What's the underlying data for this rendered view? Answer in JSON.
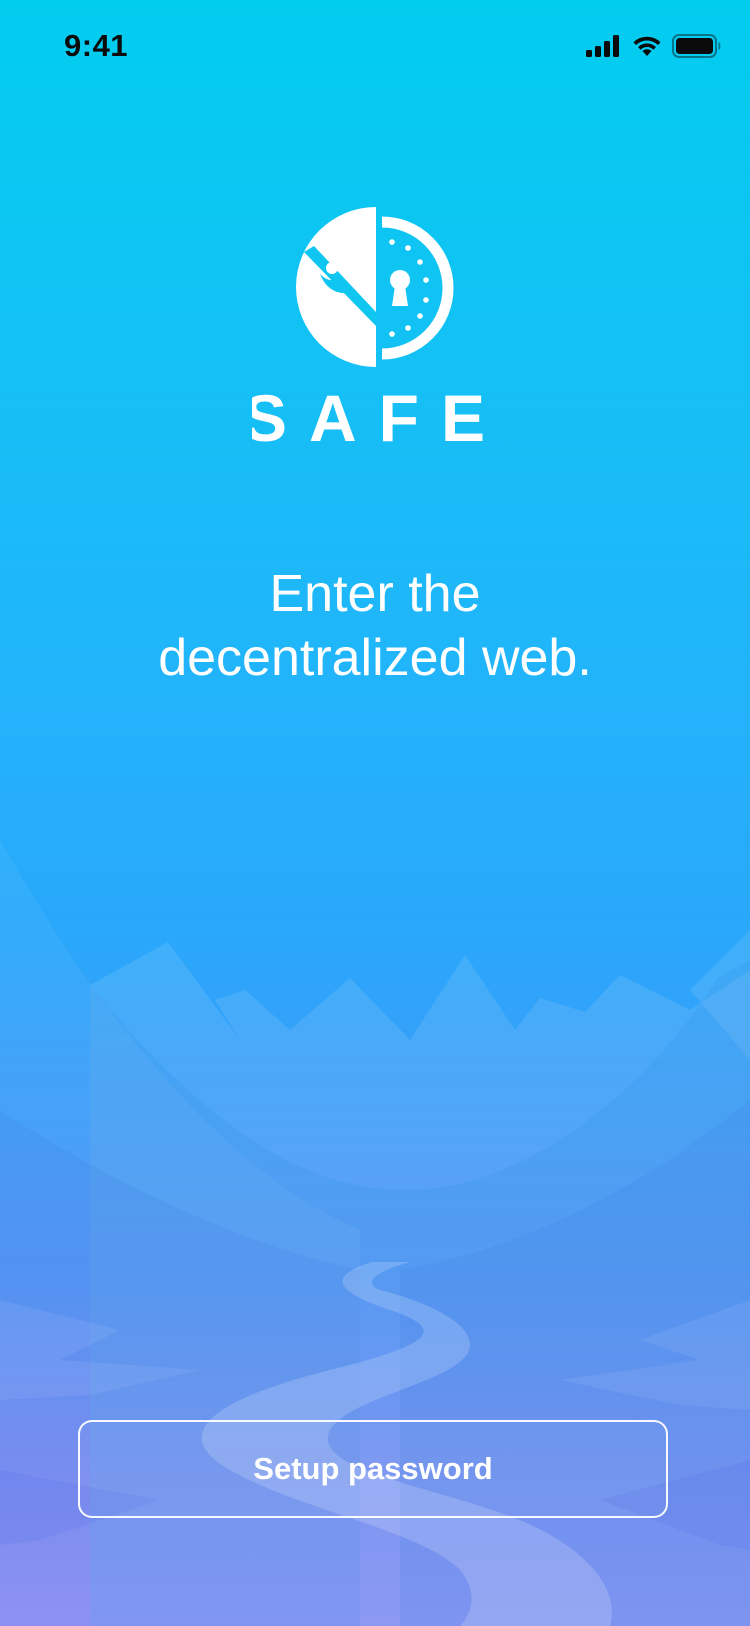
{
  "status_bar": {
    "time": "9:41",
    "icons": [
      "cellular-signal-icon",
      "wifi-icon",
      "battery-icon"
    ]
  },
  "brand": {
    "logo_icon": "safe-logo-icon",
    "wordmark": "SAFE"
  },
  "tagline": {
    "line1": "Enter the",
    "line2": "decentralized web."
  },
  "actions": {
    "setup_password_label": "Setup password"
  },
  "colors": {
    "gradient_top": "#01cdef",
    "gradient_mid": "#2aa7fb",
    "gradient_bottom": "#9b90f7",
    "text": "#ffffff"
  }
}
